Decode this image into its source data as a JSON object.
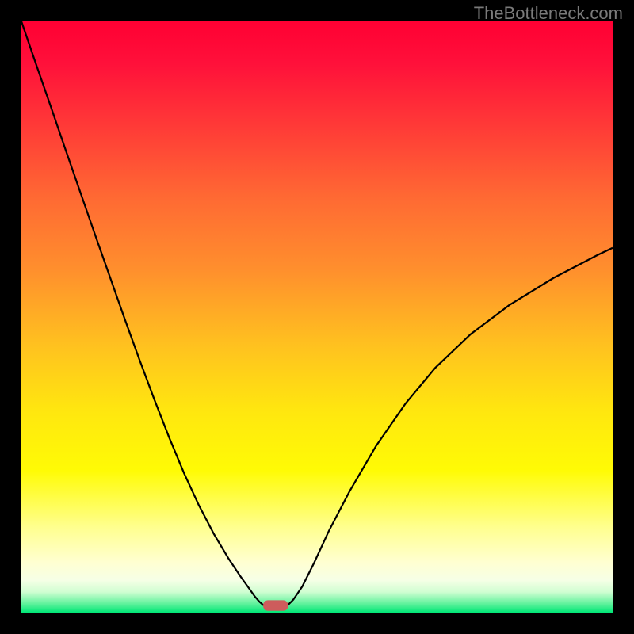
{
  "watermark": "TheBottleneck.com",
  "chart_data": {
    "type": "line",
    "title": "",
    "xlabel": "",
    "ylabel": "",
    "xlim": [
      0,
      1
    ],
    "ylim": [
      0,
      1
    ],
    "series": [
      {
        "name": "curve-left",
        "x": [
          0.0,
          0.025,
          0.05,
          0.075,
          0.1,
          0.125,
          0.15,
          0.175,
          0.2,
          0.225,
          0.25,
          0.275,
          0.3,
          0.325,
          0.35,
          0.37,
          0.385,
          0.395,
          0.403,
          0.41
        ],
        "values": [
          1.0,
          0.927,
          0.855,
          0.782,
          0.71,
          0.638,
          0.567,
          0.496,
          0.427,
          0.36,
          0.296,
          0.236,
          0.182,
          0.134,
          0.092,
          0.062,
          0.041,
          0.027,
          0.018,
          0.012
        ]
      },
      {
        "name": "curve-right",
        "x": [
          0.45,
          0.46,
          0.475,
          0.495,
          0.52,
          0.555,
          0.6,
          0.65,
          0.7,
          0.76,
          0.825,
          0.9,
          0.975,
          1.0
        ],
        "values": [
          0.012,
          0.022,
          0.044,
          0.084,
          0.138,
          0.205,
          0.282,
          0.354,
          0.414,
          0.471,
          0.52,
          0.566,
          0.605,
          0.617
        ]
      }
    ],
    "marker": {
      "name": "min-marker",
      "x_center": 0.43,
      "y": 0.012,
      "width": 0.042,
      "height": 0.018,
      "color": "#cd5c5c"
    },
    "gradient_stops": [
      {
        "offset": 0.0,
        "color": "#ff0033"
      },
      {
        "offset": 0.07,
        "color": "#ff103a"
      },
      {
        "offset": 0.18,
        "color": "#ff3b37"
      },
      {
        "offset": 0.3,
        "color": "#ff6a33"
      },
      {
        "offset": 0.42,
        "color": "#ff8f2d"
      },
      {
        "offset": 0.55,
        "color": "#ffc21f"
      },
      {
        "offset": 0.66,
        "color": "#ffe70f"
      },
      {
        "offset": 0.76,
        "color": "#fffb05"
      },
      {
        "offset": 0.855,
        "color": "#ffff8e"
      },
      {
        "offset": 0.915,
        "color": "#ffffd1"
      },
      {
        "offset": 0.945,
        "color": "#f6ffe6"
      },
      {
        "offset": 0.965,
        "color": "#d0fed2"
      },
      {
        "offset": 0.985,
        "color": "#60f29c"
      },
      {
        "offset": 1.0,
        "color": "#00e676"
      }
    ]
  }
}
